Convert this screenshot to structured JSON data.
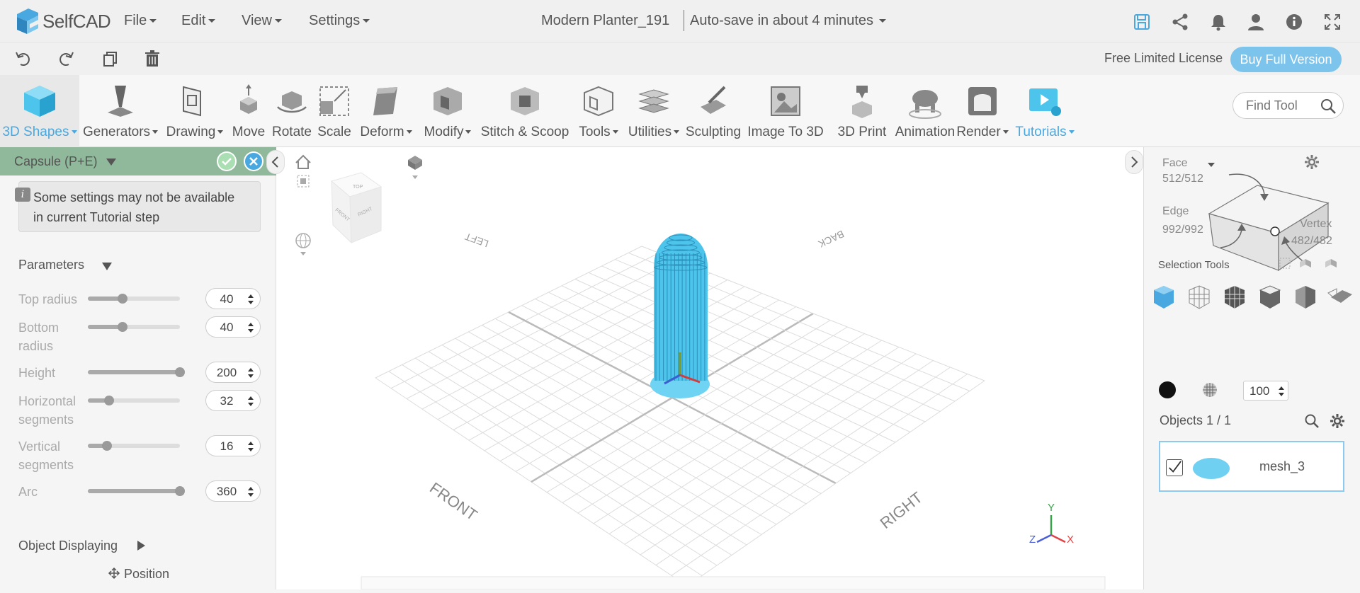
{
  "app": {
    "brand": "SelfCAD",
    "brand_color": "#4aa8e0",
    "menus": [
      "File",
      "Edit",
      "View",
      "Settings"
    ],
    "document_title": "Modern Planter_191",
    "autosave": "Auto-save in about 4 minutes",
    "top_icons": [
      "save-icon",
      "share-icon",
      "bell-icon",
      "user-icon",
      "info-icon",
      "fullscreen-icon"
    ]
  },
  "toolbar2": {
    "icons": [
      "undo-icon",
      "redo-icon",
      "copy-icon",
      "trash-icon"
    ],
    "license": "Free Limited License",
    "buy_label": "Buy Full Version"
  },
  "ribbon": {
    "tools": [
      {
        "label": "3D Shapes",
        "dropdown": true,
        "active": true,
        "blue": true
      },
      {
        "label": "Generators",
        "dropdown": true
      },
      {
        "label": "Drawing",
        "dropdown": true
      },
      {
        "label": "Move"
      },
      {
        "label": "Rotate"
      },
      {
        "label": "Scale"
      },
      {
        "label": "Deform",
        "dropdown": true
      },
      {
        "label": "Modify",
        "dropdown": true
      },
      {
        "label": "Stitch & Scoop"
      },
      {
        "label": "Tools",
        "dropdown": true
      },
      {
        "label": "Utilities",
        "dropdown": true
      },
      {
        "label": "Sculpting"
      },
      {
        "label": "Image To 3D"
      },
      {
        "label": "3D Print"
      },
      {
        "label": "Animation"
      },
      {
        "label": "Render",
        "dropdown": true
      },
      {
        "label": "Tutorials",
        "dropdown": true,
        "blue": true
      }
    ],
    "find_tool_placeholder": "Find Tool"
  },
  "left_panel": {
    "title": "Capsule (P+E)",
    "info": "Some settings may not be available in current Tutorial step",
    "parameters_title": "Parameters",
    "params": [
      {
        "label": "Top radius",
        "value": "40",
        "level": 0.38
      },
      {
        "label": "Bottom radius",
        "value": "40",
        "level": 0.38
      },
      {
        "label": "Height",
        "value": "200",
        "level": 1.0
      },
      {
        "label": "Horizontal segments",
        "value": "32",
        "level": 0.23
      },
      {
        "label": "Vertical segments",
        "value": "16",
        "level": 0.21
      },
      {
        "label": "Arc",
        "value": "360",
        "level": 1.0
      }
    ],
    "object_displaying_title": "Object Displaying",
    "position_label": "Position"
  },
  "viewport": {
    "grid_labels": {
      "left": "LEFT",
      "back": "BACK",
      "front": "FRONT",
      "right": "RIGHT"
    },
    "view_cube": {
      "top": "TOP",
      "front": "FRONT",
      "right": "RIGHT"
    },
    "axes": {
      "y": "Y",
      "z": "Z",
      "x": "X"
    },
    "mesh_color": "#4cc4ec"
  },
  "right_panel": {
    "face_label": "Face",
    "face_count": "512/512",
    "edge_label": "Edge",
    "edge_count": "992/992",
    "vertex_label": "Vertex",
    "vertex_count": "482/482",
    "selection_tools_label": "Selection Tools",
    "opacity_value": "100",
    "objects_label": "Objects 1 / 1",
    "objects": [
      {
        "name": "mesh_3",
        "checked": true
      }
    ]
  }
}
